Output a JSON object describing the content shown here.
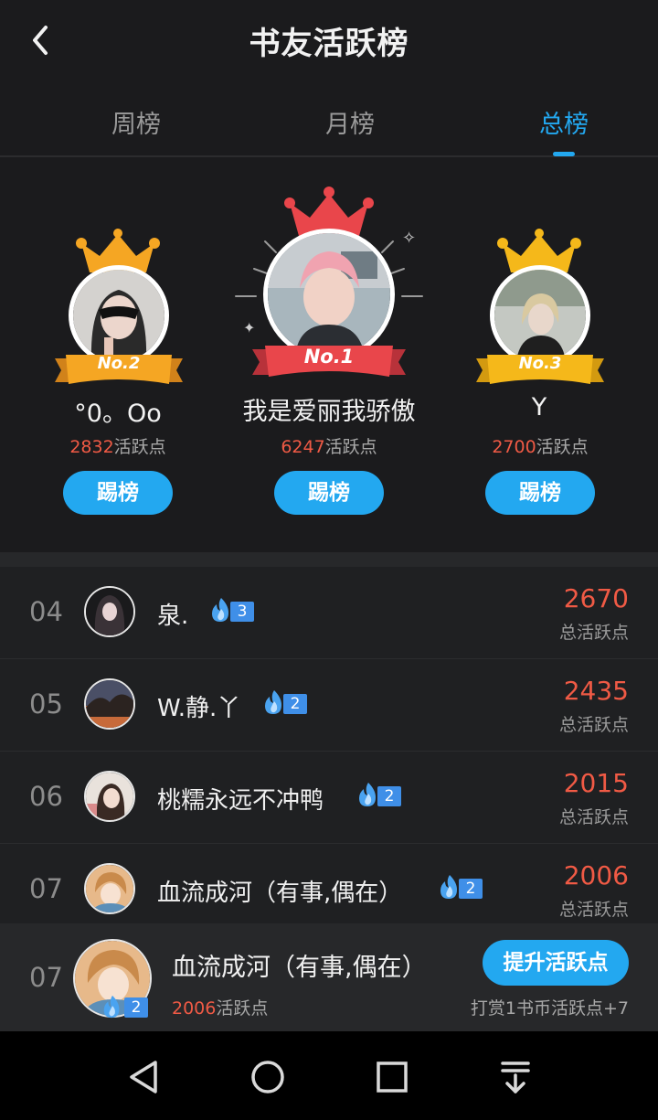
{
  "header": {
    "title": "书友活跃榜"
  },
  "tabs": [
    {
      "label": "周榜",
      "active": false
    },
    {
      "label": "月榜",
      "active": false
    },
    {
      "label": "总榜",
      "active": true
    }
  ],
  "podium": {
    "first": {
      "rank_label": "No.1",
      "name": "我是爱丽我骄傲",
      "points": "6247",
      "points_suffix": "活跃点",
      "button": "踢榜"
    },
    "second": {
      "rank_label": "No.2",
      "name": "°0。Oo",
      "points": "2832",
      "points_suffix": "活跃点",
      "button": "踢榜"
    },
    "third": {
      "rank_label": "No.3",
      "name": "Y",
      "points": "2700",
      "points_suffix": "活跃点",
      "button": "踢榜"
    }
  },
  "list": [
    {
      "rank": "04",
      "name": "泉.",
      "level": "3",
      "points": "2670",
      "points_label": "总活跃点"
    },
    {
      "rank": "05",
      "name": "W.静.丫",
      "level": "2",
      "points": "2435",
      "points_label": "总活跃点"
    },
    {
      "rank": "06",
      "name": "桃糯永远不冲鸭",
      "level": "2",
      "points": "2015",
      "points_label": "总活跃点"
    },
    {
      "rank": "07",
      "name": "血流成河（有事,偶在）",
      "level": "2",
      "points": "2006",
      "points_label": "总活跃点"
    }
  ],
  "me": {
    "rank": "07",
    "name": "血流成河（有事,偶在）",
    "level": "2",
    "points": "2006",
    "points_suffix": "活跃点",
    "button": "提升活跃点",
    "tip": "打赏1书币活跃点+7"
  },
  "colors": {
    "accent": "#23a8f0",
    "points": "#f05a45",
    "gold": "#f5a623",
    "red": "#e9464b"
  }
}
